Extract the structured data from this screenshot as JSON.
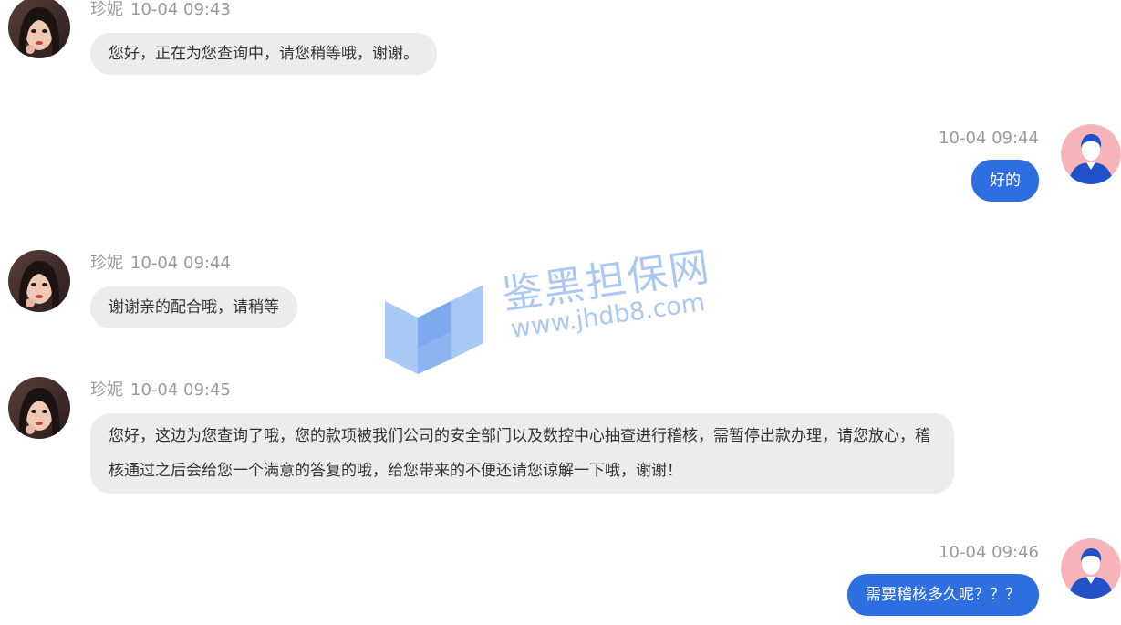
{
  "colors": {
    "agent_bubble": "#ececec",
    "user_bubble": "#2d6fe0",
    "meta_text": "#9a9a9a",
    "watermark": "#8fb6f2"
  },
  "messages": [
    {
      "side": "left",
      "name": "珍妮",
      "time": "10-04 09:43",
      "avatar_icon": "woman-portrait-avatar",
      "text": "您好，正在为您查询中，请您稍等哦，谢谢。"
    },
    {
      "side": "right",
      "time": "10-04 09:44",
      "avatar_icon": "user-silhouette-avatar",
      "text": "好的"
    },
    {
      "side": "left",
      "name": "珍妮",
      "time": "10-04 09:44",
      "avatar_icon": "woman-portrait-avatar",
      "text": "谢谢亲的配合哦，请稍等"
    },
    {
      "side": "left",
      "name": "珍妮",
      "time": "10-04 09:45",
      "avatar_icon": "woman-portrait-avatar",
      "text": "您好，这边为您查询了哦，您的款项被我们公司的安全部门以及数控中心抽查进行稽核，需暂停出款办理，请您放心，稽核通过之后会给您一个满意的答复的哦，给您带来的不便还请您谅解一下哦，谢谢！"
    },
    {
      "side": "right",
      "time": "10-04 09:46",
      "avatar_icon": "user-silhouette-avatar",
      "text": "需要稽核多久呢？？？"
    }
  ],
  "watermark": {
    "brand": "鉴黑担保网",
    "url": "www.jhdb8.com",
    "logo_icon": "shield-check-logo-icon"
  }
}
